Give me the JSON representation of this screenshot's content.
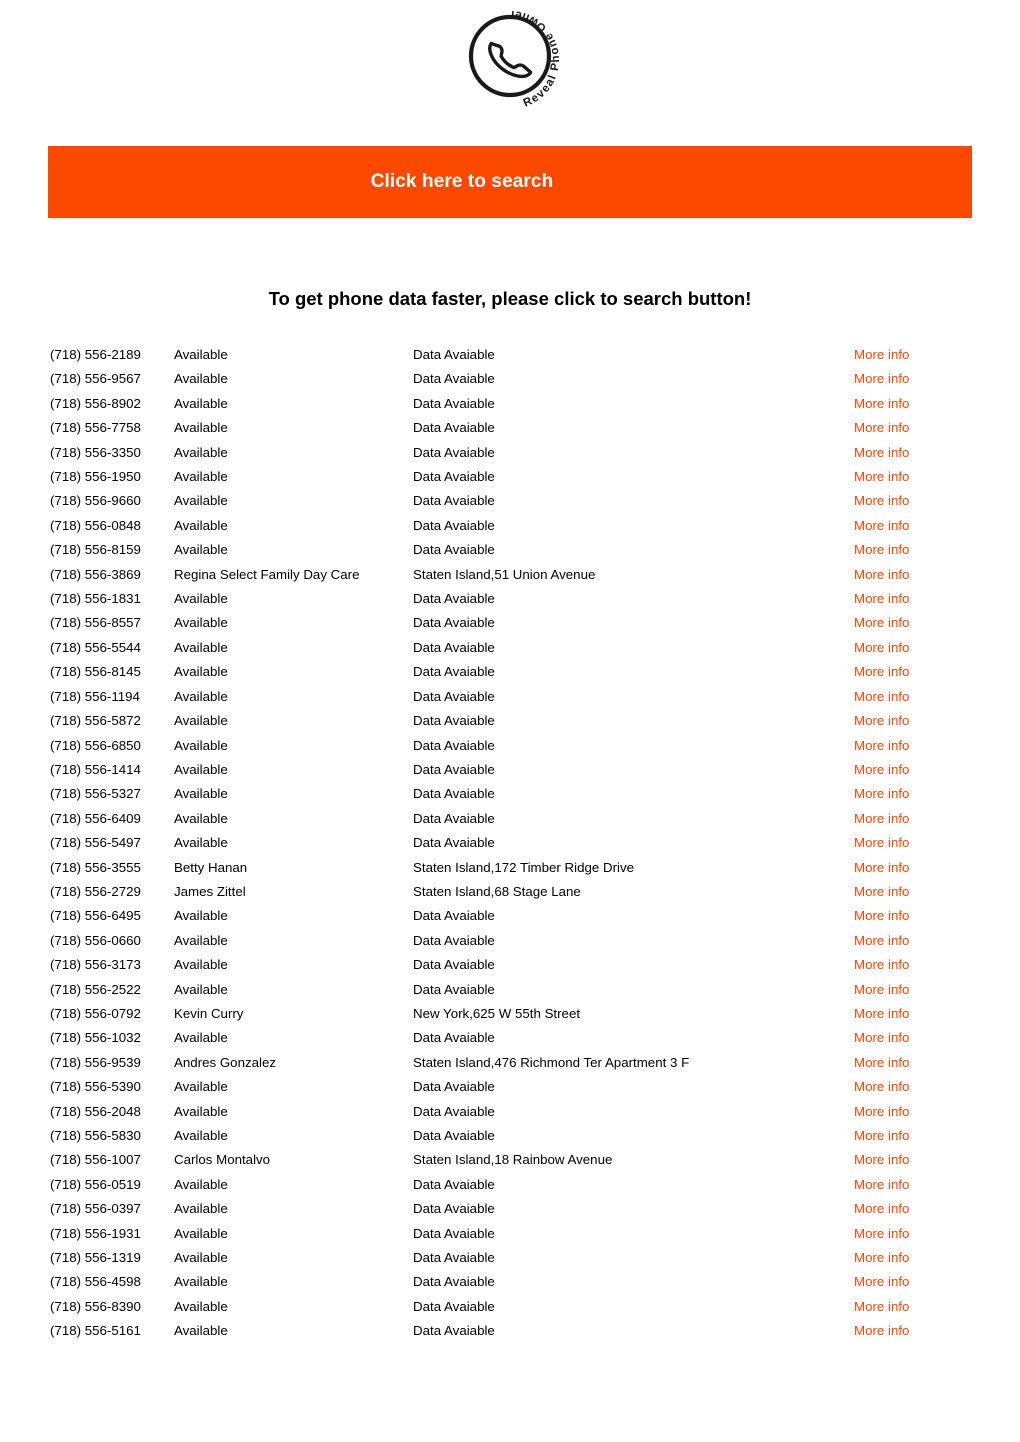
{
  "logo": {
    "icon": "phone-handset-icon",
    "text_top_left": "Reveal",
    "text_bottom": "Phone",
    "text_top_right": "Owner",
    "alt": "Reveal Phone Owner"
  },
  "search_banner": {
    "label": "Click here to search",
    "background_color": "#fb4900",
    "text_color": "#ffffff"
  },
  "headline": "To get phone data faster, please click to search button!",
  "link_color": "#ff4500",
  "more_info_label": "More info",
  "placeholders": {
    "name": "Available",
    "address": "Data Avaiable"
  },
  "rows": [
    {
      "phone": "(718) 556-2189",
      "name": "Available",
      "address": "Data Avaiable",
      "link": "More info"
    },
    {
      "phone": "(718) 556-9567",
      "name": "Available",
      "address": "Data Avaiable",
      "link": "More info"
    },
    {
      "phone": "(718) 556-8902",
      "name": "Available",
      "address": "Data Avaiable",
      "link": "More info"
    },
    {
      "phone": "(718) 556-7758",
      "name": "Available",
      "address": "Data Avaiable",
      "link": "More info"
    },
    {
      "phone": "(718) 556-3350",
      "name": "Available",
      "address": "Data Avaiable",
      "link": "More info"
    },
    {
      "phone": "(718) 556-1950",
      "name": "Available",
      "address": "Data Avaiable",
      "link": "More info"
    },
    {
      "phone": "(718) 556-9660",
      "name": "Available",
      "address": "Data Avaiable",
      "link": "More info"
    },
    {
      "phone": "(718) 556-0848",
      "name": "Available",
      "address": "Data Avaiable",
      "link": "More info"
    },
    {
      "phone": "(718) 556-8159",
      "name": "Available",
      "address": "Data Avaiable",
      "link": "More info"
    },
    {
      "phone": "(718) 556-3869",
      "name": "Regina Select Family Day Care",
      "address": "Staten Island,51 Union Avenue",
      "link": "More info"
    },
    {
      "phone": "(718) 556-1831",
      "name": "Available",
      "address": "Data Avaiable",
      "link": "More info"
    },
    {
      "phone": "(718) 556-8557",
      "name": "Available",
      "address": "Data Avaiable",
      "link": "More info"
    },
    {
      "phone": "(718) 556-5544",
      "name": "Available",
      "address": "Data Avaiable",
      "link": "More info"
    },
    {
      "phone": "(718) 556-8145",
      "name": "Available",
      "address": "Data Avaiable",
      "link": "More info"
    },
    {
      "phone": "(718) 556-1194",
      "name": "Available",
      "address": "Data Avaiable",
      "link": "More info"
    },
    {
      "phone": "(718) 556-5872",
      "name": "Available",
      "address": "Data Avaiable",
      "link": "More info"
    },
    {
      "phone": "(718) 556-6850",
      "name": "Available",
      "address": "Data Avaiable",
      "link": "More info"
    },
    {
      "phone": "(718) 556-1414",
      "name": "Available",
      "address": "Data Avaiable",
      "link": "More info"
    },
    {
      "phone": "(718) 556-5327",
      "name": "Available",
      "address": "Data Avaiable",
      "link": "More info"
    },
    {
      "phone": "(718) 556-6409",
      "name": "Available",
      "address": "Data Avaiable",
      "link": "More info"
    },
    {
      "phone": "(718) 556-5497",
      "name": "Available",
      "address": "Data Avaiable",
      "link": "More info"
    },
    {
      "phone": "(718) 556-3555",
      "name": "Betty Hanan",
      "address": "Staten Island,172 Timber Ridge Drive",
      "link": "More info"
    },
    {
      "phone": "(718) 556-2729",
      "name": "James Zittel",
      "address": "Staten Island,68 Stage Lane",
      "link": "More info"
    },
    {
      "phone": "(718) 556-6495",
      "name": "Available",
      "address": "Data Avaiable",
      "link": "More info"
    },
    {
      "phone": "(718) 556-0660",
      "name": "Available",
      "address": "Data Avaiable",
      "link": "More info"
    },
    {
      "phone": "(718) 556-3173",
      "name": "Available",
      "address": "Data Avaiable",
      "link": "More info"
    },
    {
      "phone": "(718) 556-2522",
      "name": "Available",
      "address": "Data Avaiable",
      "link": "More info"
    },
    {
      "phone": "(718) 556-0792",
      "name": "Kevin Curry",
      "address": "New York,625 W 55th Street",
      "link": "More info"
    },
    {
      "phone": "(718) 556-1032",
      "name": "Available",
      "address": "Data Avaiable",
      "link": "More info"
    },
    {
      "phone": "(718) 556-9539",
      "name": "Andres Gonzalez",
      "address": "Staten Island,476 Richmond Ter Apartment 3 F",
      "link": "More info"
    },
    {
      "phone": "(718) 556-5390",
      "name": "Available",
      "address": "Data Avaiable",
      "link": "More info"
    },
    {
      "phone": "(718) 556-2048",
      "name": "Available",
      "address": "Data Avaiable",
      "link": "More info"
    },
    {
      "phone": "(718) 556-5830",
      "name": "Available",
      "address": "Data Avaiable",
      "link": "More info"
    },
    {
      "phone": "(718) 556-1007",
      "name": "Carlos Montalvo",
      "address": "Staten Island,18 Rainbow Avenue",
      "link": "More info"
    },
    {
      "phone": "(718) 556-0519",
      "name": "Available",
      "address": "Data Avaiable",
      "link": "More info"
    },
    {
      "phone": "(718) 556-0397",
      "name": "Available",
      "address": "Data Avaiable",
      "link": "More info"
    },
    {
      "phone": "(718) 556-1931",
      "name": "Available",
      "address": "Data Avaiable",
      "link": "More info"
    },
    {
      "phone": "(718) 556-1319",
      "name": "Available",
      "address": "Data Avaiable",
      "link": "More info"
    },
    {
      "phone": "(718) 556-4598",
      "name": "Available",
      "address": "Data Avaiable",
      "link": "More info"
    },
    {
      "phone": "(718) 556-8390",
      "name": "Available",
      "address": "Data Avaiable",
      "link": "More info"
    },
    {
      "phone": "(718) 556-5161",
      "name": "Available",
      "address": "Data Avaiable",
      "link": "More info"
    }
  ]
}
